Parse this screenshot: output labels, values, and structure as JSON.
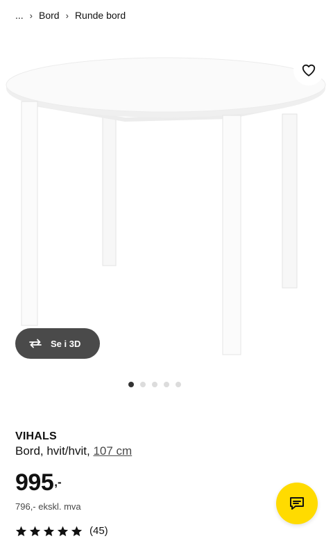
{
  "breadcrumb": {
    "ellipsis": "...",
    "items": [
      "Bord",
      "Runde bord"
    ]
  },
  "gallery": {
    "view_3d_label": "Se i 3D",
    "dots": {
      "count": 5,
      "active_index": 0
    }
  },
  "product": {
    "name": "VIHALS",
    "description": "Bord, hvit/hvit,",
    "size_link": "107 cm",
    "price": "995",
    "price_suffix": ",-",
    "price_ex_vat": "796,- ekskl. mva",
    "rating": 5,
    "review_count": "(45)"
  },
  "colors": {
    "accent_yellow": "#ffdb00",
    "dark_button": "#4a4a4a",
    "active_dot": "#333333",
    "inactive_dot": "#dcdcdc"
  },
  "icons": {
    "favorite": "heart-icon",
    "view_3d": "rotate-3d-icon",
    "chat": "chat-bubble-icon",
    "breadcrumb_separator": "chevron-right-icon",
    "star": "star-icon"
  }
}
